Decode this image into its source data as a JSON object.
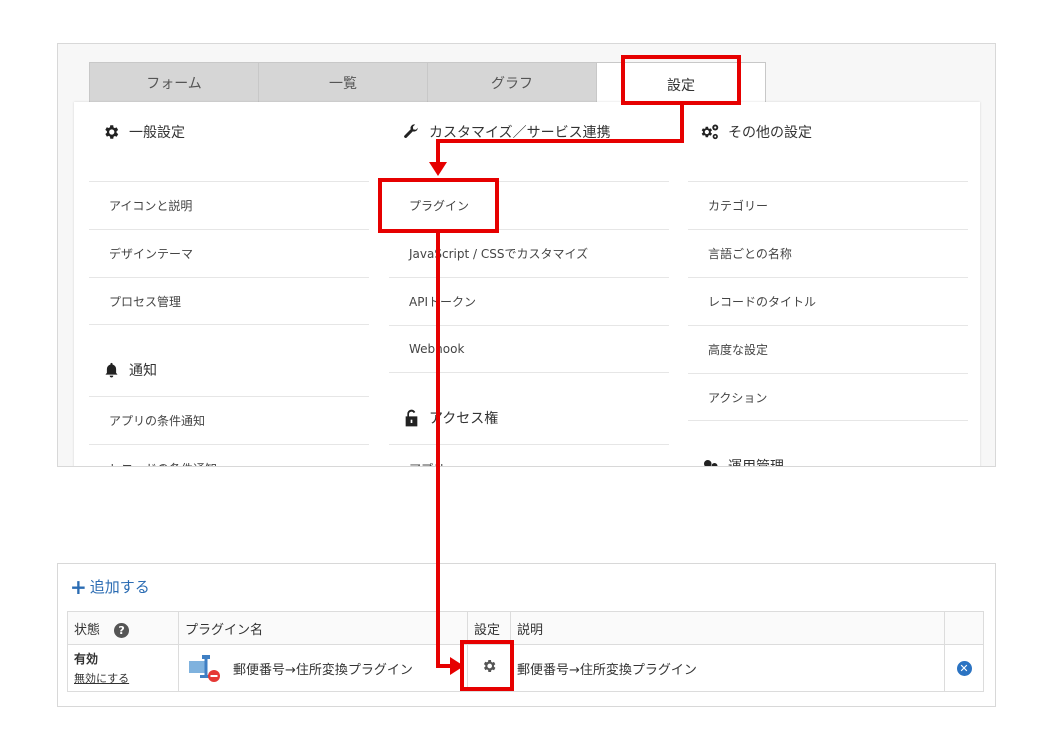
{
  "tabs": [
    {
      "label": "フォーム"
    },
    {
      "label": "一覧"
    },
    {
      "label": "グラフ"
    },
    {
      "label": "設定",
      "active": true
    }
  ],
  "sections": {
    "general": {
      "title": "一般設定",
      "icon": "gear-icon",
      "items": [
        "アイコンと説明",
        "デザインテーマ",
        "プロセス管理"
      ]
    },
    "notify": {
      "title": "通知",
      "icon": "bell-icon",
      "items": [
        "アプリの条件通知",
        "レコードの条件通知"
      ]
    },
    "customize": {
      "title": "カスタマイズ／サービス連携",
      "icon": "wrench-icon",
      "items": [
        "プラグイン",
        "JavaScript / CSSでカスタマイズ",
        "APIトークン",
        "Webhook"
      ]
    },
    "access": {
      "title": "アクセス権",
      "icon": "lock-icon",
      "items": [
        "アプリ"
      ]
    },
    "other": {
      "title": "その他の設定",
      "icon": "gears-icon",
      "items": [
        "カテゴリー",
        "言語ごとの名称",
        "レコードのタイトル",
        "高度な設定",
        "アクション"
      ]
    },
    "ops": {
      "title": "運用管理",
      "icon": "ops-icon"
    }
  },
  "plugins": {
    "add_label": "追加する",
    "headers": {
      "status": "状態",
      "name": "プラグイン名",
      "settings": "設定",
      "description": "説明"
    },
    "rows": [
      {
        "status": "有効",
        "status_action": "無効にする",
        "name": "郵便番号→住所変換プラグイン",
        "description": "郵便番号→住所変換プラグイン"
      }
    ]
  },
  "colors": {
    "annotation": "#e60000",
    "link": "#2b6cb3"
  }
}
